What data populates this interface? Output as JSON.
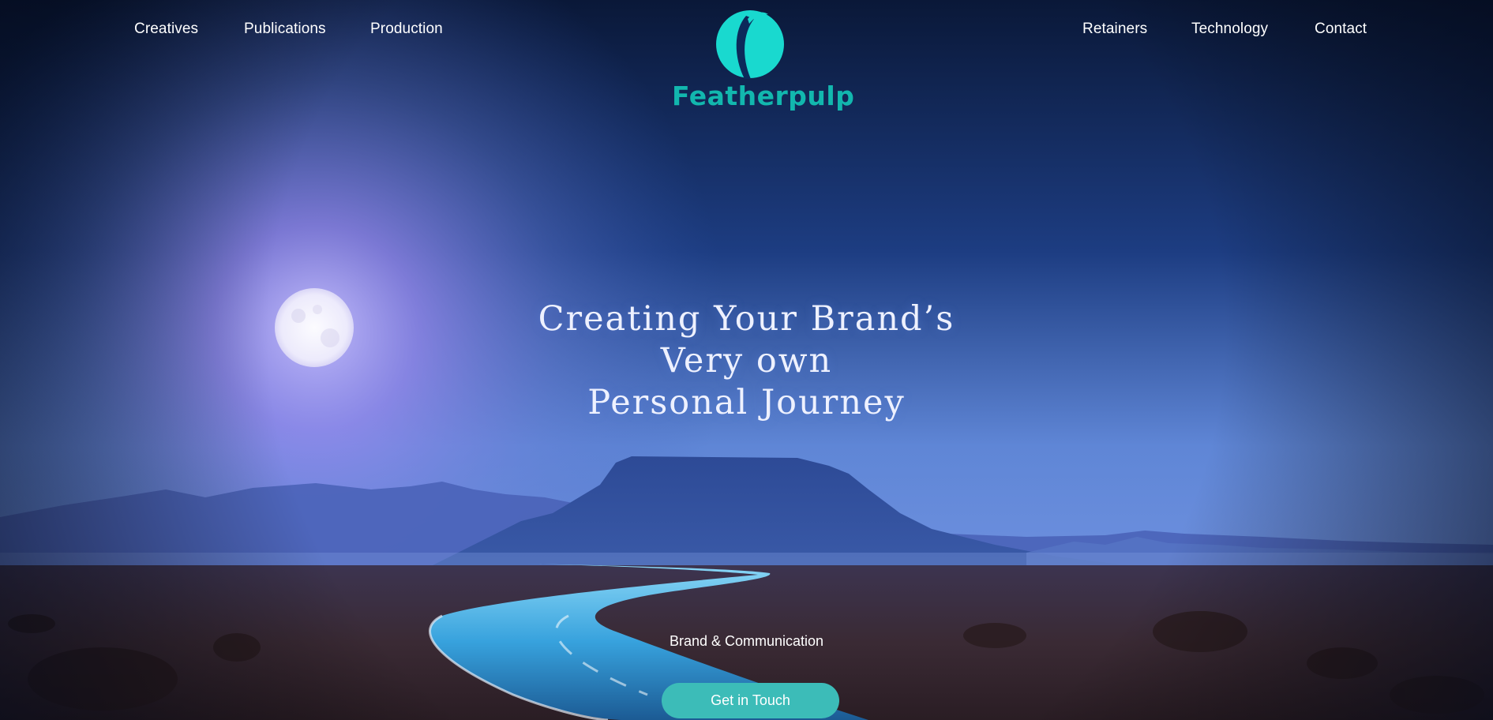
{
  "nav": {
    "left": [
      "Creatives",
      "Publications",
      "Production"
    ],
    "right": [
      "Retainers",
      "Technology",
      "Contact"
    ]
  },
  "logo": {
    "name": "Featherpulp",
    "icon": "feather-leaf-icon"
  },
  "hero": {
    "headline": [
      "Creating Your Brand’s",
      "Very own",
      "Personal Journey"
    ],
    "tagline": "Brand & Communication",
    "cta_label": "Get in Touch"
  },
  "colors": {
    "accent": "#12b7ae",
    "button": "#3cbcb8",
    "sky_top": "#0d1f45",
    "sky_glow": "#8f8be8",
    "text": "#ffffff"
  }
}
